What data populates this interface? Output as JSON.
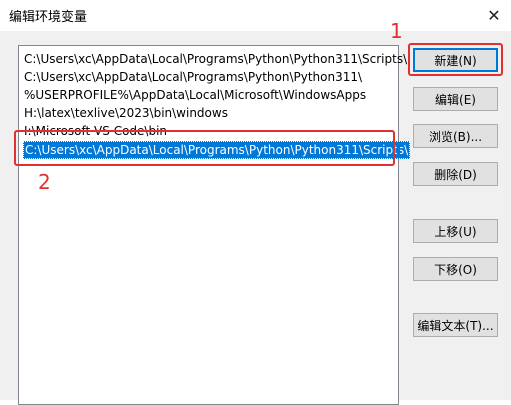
{
  "window": {
    "title": "编辑环境变量",
    "close_glyph": "✕"
  },
  "list": {
    "items": [
      "C:\\Users\\xc\\AppData\\Local\\Programs\\Python\\Python311\\Scripts\\",
      "C:\\Users\\xc\\AppData\\Local\\Programs\\Python\\Python311\\",
      "%USERPROFILE%\\AppData\\Local\\Microsoft\\WindowsApps",
      "H:\\latex\\texlive\\2023\\bin\\windows",
      "I:\\Microsoft VS Code\\bin"
    ],
    "selected_value": "C:\\Users\\xc\\AppData\\Local\\Programs\\Python\\Python311\\Scripts\\"
  },
  "buttons": {
    "new": "新建(N)",
    "edit": "编辑(E)",
    "browse": "浏览(B)...",
    "delete": "删除(D)",
    "move_up": "上移(U)",
    "move_down": "下移(O)",
    "edit_text": "编辑文本(T)..."
  },
  "annotations": {
    "label_1": "1",
    "label_2": "2",
    "color": "#e03030"
  },
  "colors": {
    "selection": "#0078d7",
    "dialog_bg": "#f0f0f0"
  }
}
